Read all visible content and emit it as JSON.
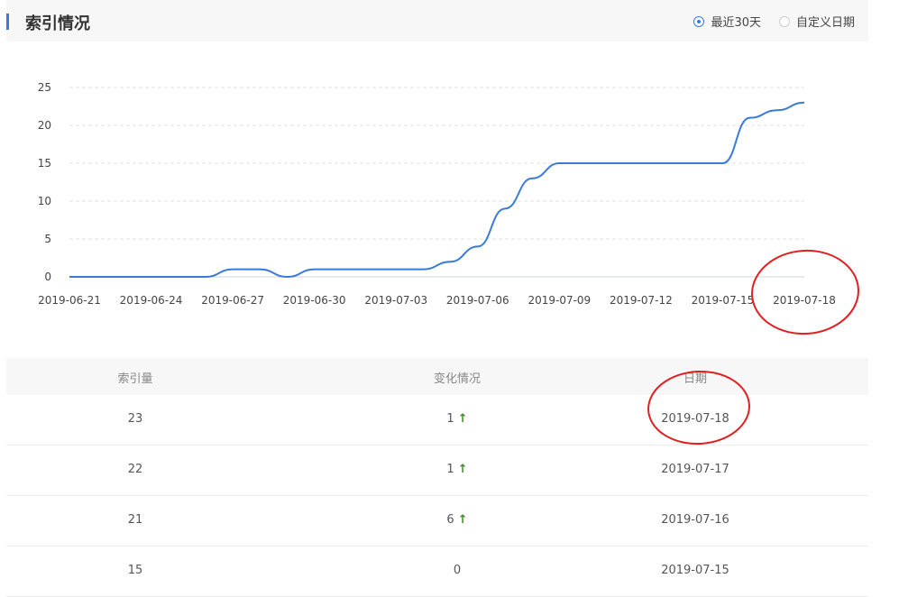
{
  "header": {
    "title": "索引情况",
    "radio_options": [
      {
        "label": "最近30天",
        "checked": true
      },
      {
        "label": "自定义日期",
        "checked": false
      }
    ]
  },
  "chart_data": {
    "type": "line",
    "x": [
      "2019-06-21",
      "2019-06-22",
      "2019-06-23",
      "2019-06-24",
      "2019-06-25",
      "2019-06-26",
      "2019-06-27",
      "2019-06-28",
      "2019-06-29",
      "2019-06-30",
      "2019-07-01",
      "2019-07-02",
      "2019-07-03",
      "2019-07-04",
      "2019-07-05",
      "2019-07-06",
      "2019-07-07",
      "2019-07-08",
      "2019-07-09",
      "2019-07-10",
      "2019-07-11",
      "2019-07-12",
      "2019-07-13",
      "2019-07-14",
      "2019-07-15",
      "2019-07-16",
      "2019-07-17",
      "2019-07-18"
    ],
    "x_tick_labels": [
      "2019-06-21",
      "2019-06-24",
      "2019-06-27",
      "2019-06-30",
      "2019-07-03",
      "2019-07-06",
      "2019-07-09",
      "2019-07-12",
      "2019-07-15",
      "2019-07-18"
    ],
    "series": [
      {
        "values": [
          0,
          0,
          0,
          0,
          0,
          0,
          1,
          1,
          0,
          1,
          1,
          1,
          1,
          1,
          2,
          4,
          9,
          13,
          15,
          15,
          15,
          15,
          15,
          15,
          15,
          21,
          22,
          23
        ]
      }
    ],
    "ylim": [
      0,
      25
    ],
    "yticks": [
      0,
      5,
      10,
      15,
      20,
      25
    ],
    "grid": true,
    "colors": {
      "line": "#3a7ad9",
      "grid": "#e0e0e0"
    }
  },
  "table": {
    "headers": [
      "索引量",
      "变化情况",
      "日期"
    ],
    "rows": [
      {
        "count": "23",
        "change": "1",
        "trend": "up",
        "date": "2019-07-18"
      },
      {
        "count": "22",
        "change": "1",
        "trend": "up",
        "date": "2019-07-17"
      },
      {
        "count": "21",
        "change": "6",
        "trend": "up",
        "date": "2019-07-16"
      },
      {
        "count": "15",
        "change": "0",
        "trend": "none",
        "date": "2019-07-15"
      }
    ]
  },
  "colors": {
    "accent": "#3a7ad9",
    "trend_up": "#3d8f2a",
    "annotation": "#e02020"
  },
  "icons": {
    "trend_up": "arrow-up-icon"
  }
}
